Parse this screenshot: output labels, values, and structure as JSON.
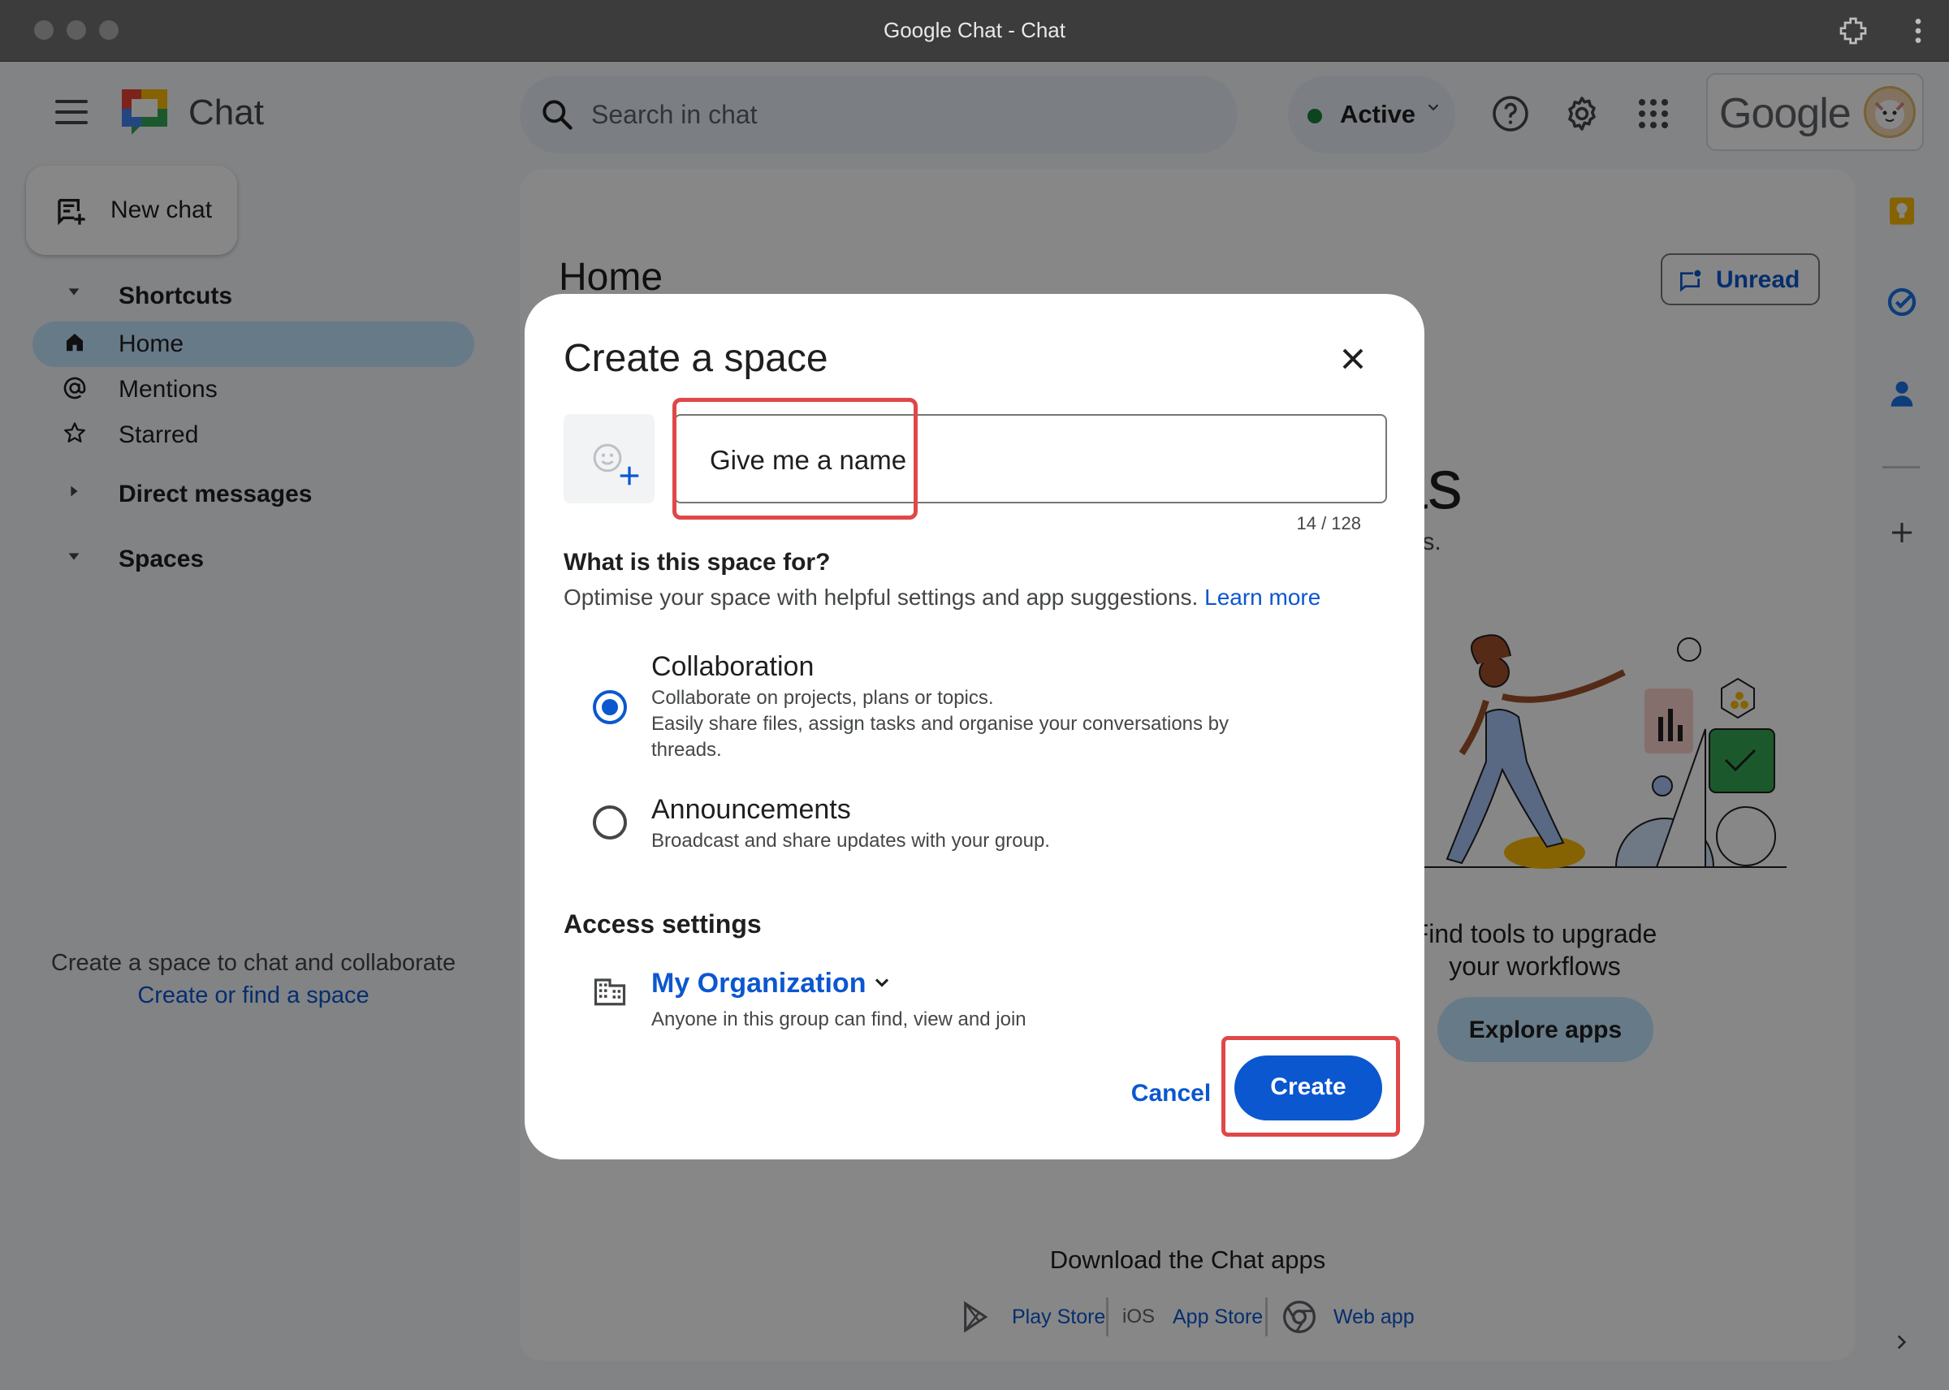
{
  "window": {
    "title": "Google Chat - Chat"
  },
  "header": {
    "app_name": "Chat",
    "search_placeholder": "Search in chat",
    "status": "Active",
    "account_brand": "Google"
  },
  "sidebar": {
    "new_chat": "New chat",
    "shortcuts_heading": "Shortcuts",
    "items": [
      {
        "label": "Home",
        "icon": "home-icon",
        "active": true
      },
      {
        "label": "Mentions",
        "icon": "at-icon",
        "active": false
      },
      {
        "label": "Starred",
        "icon": "star-icon",
        "active": false
      }
    ],
    "direct_messages_heading": "Direct messages",
    "spaces_heading": "Spaces",
    "empty_message": "Create a space to chat and collaborate",
    "empty_link": "Create or find a space"
  },
  "main": {
    "title": "Home",
    "unread_button": "Unread",
    "hero_fragment": "as",
    "hero_sub_fragment": "ngs.",
    "tools_text_line1": "Find tools to upgrade",
    "tools_text_line2": "your workflows",
    "explore_button": "Explore apps",
    "download_title": "Download the Chat apps",
    "download_links": [
      "Play Store",
      "App Store",
      "Web app"
    ],
    "ios_label": "iOS"
  },
  "dialog": {
    "title": "Create a space",
    "name_value": "Give me a name",
    "char_count": "14 / 128",
    "purpose_title": "What is this space for?",
    "purpose_desc": "Optimise your space with helpful settings and app suggestions.",
    "learn_more": "Learn more",
    "options": [
      {
        "title": "Collaboration",
        "desc_lines": [
          "Collaborate on projects, plans or topics.",
          "Easily share files, assign tasks and organise your conversations by threads."
        ],
        "selected": true
      },
      {
        "title": "Announcements",
        "desc_lines": [
          "Broadcast and share updates with your group."
        ],
        "selected": false
      }
    ],
    "access_title": "Access settings",
    "access_value": "My Organization",
    "access_desc": "Anyone in this group can find, view and join",
    "cancel": "Cancel",
    "create": "Create"
  },
  "colors": {
    "accent": "#0b57d0",
    "active_nav": "#c2e7ff",
    "status_green": "#188038",
    "highlight_red": "#e04848"
  }
}
